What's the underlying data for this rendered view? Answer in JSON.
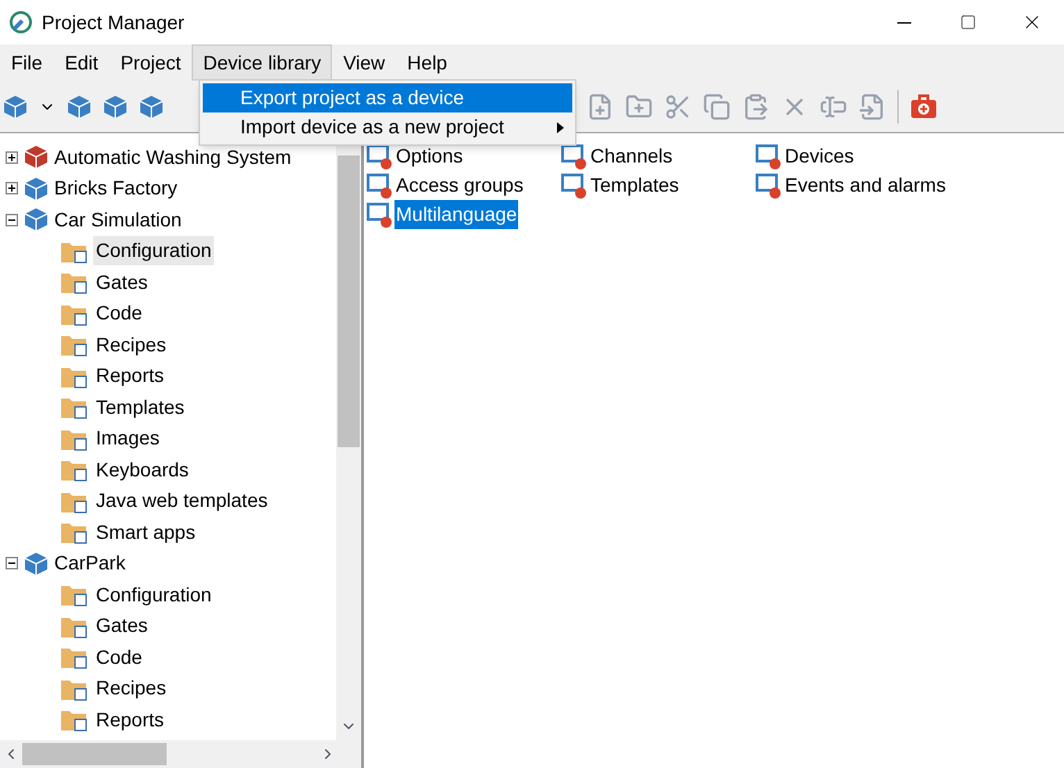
{
  "window": {
    "title": "Project Manager"
  },
  "menu_bar": [
    {
      "label": "File",
      "open": false
    },
    {
      "label": "Edit",
      "open": false
    },
    {
      "label": "Project",
      "open": false
    },
    {
      "label": "Device library",
      "open": true
    },
    {
      "label": "View",
      "open": false
    },
    {
      "label": "Help",
      "open": false
    }
  ],
  "dropdown": [
    {
      "label": "Export project as a device",
      "selected": true,
      "submenu": false
    },
    {
      "label": "Import device as a new project",
      "selected": false,
      "submenu": true
    }
  ],
  "tree": [
    {
      "label": "Automatic Washing System",
      "color": "#c0392b",
      "expanded": false
    },
    {
      "label": "Bricks Factory",
      "color": "#3a7fc4",
      "expanded": false
    },
    {
      "label": "Car Simulation",
      "color": "#3a7fc4",
      "expanded": true,
      "children": [
        {
          "label": "Configuration",
          "selected": true
        },
        {
          "label": "Gates",
          "selected": false
        },
        {
          "label": "Code",
          "selected": false
        },
        {
          "label": "Recipes",
          "selected": false
        },
        {
          "label": "Reports",
          "selected": false
        },
        {
          "label": "Templates",
          "selected": false
        },
        {
          "label": "Images",
          "selected": false
        },
        {
          "label": "Keyboards",
          "selected": false
        },
        {
          "label": "Java web templates",
          "selected": false
        },
        {
          "label": "Smart apps",
          "selected": false
        }
      ]
    },
    {
      "label": "CarPark",
      "color": "#3a7fc4",
      "expanded": true,
      "children": [
        {
          "label": "Configuration",
          "selected": false
        },
        {
          "label": "Gates",
          "selected": false
        },
        {
          "label": "Code",
          "selected": false
        },
        {
          "label": "Recipes",
          "selected": false
        },
        {
          "label": "Reports",
          "selected": false
        }
      ]
    }
  ],
  "items": [
    {
      "label": "Options",
      "selected": false
    },
    {
      "label": "Channels",
      "selected": false
    },
    {
      "label": "Devices",
      "selected": false
    },
    {
      "label": "Access groups",
      "selected": false
    },
    {
      "label": "Templates",
      "selected": false
    },
    {
      "label": "Events and alarms",
      "selected": false
    },
    {
      "label": "Multilanguage",
      "selected": true
    }
  ]
}
